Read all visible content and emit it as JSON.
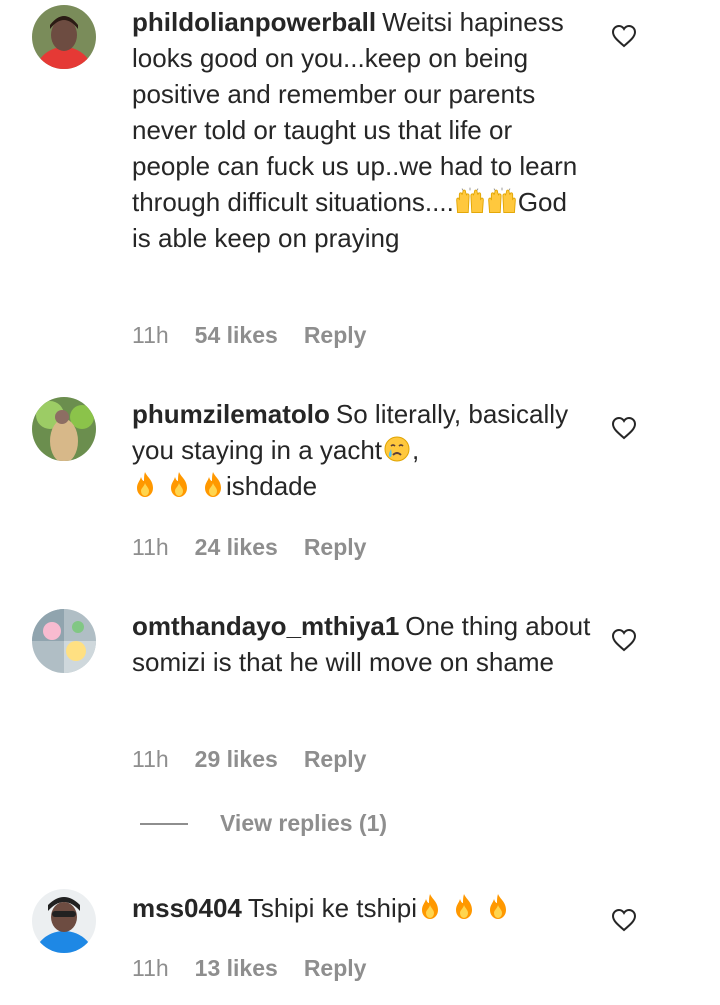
{
  "comments": [
    {
      "username": "phildolianpowerball",
      "text_1": "Weitsi hapiness looks good on you...keep on being positive and remember our parents never told or taught us that life or people can fuck us up..we had to learn through difficult situations....",
      "text_2": "God is able keep on praying",
      "time": "11h",
      "likes": "54 likes",
      "reply": "Reply"
    },
    {
      "username": "phumzilematolo",
      "text_1": "So literally, basically you staying in a yacht",
      "text_2": ",",
      "text_3": "ishdade",
      "time": "11h",
      "likes": "24 likes",
      "reply": "Reply"
    },
    {
      "username": "omthandayo_mthiya1",
      "text_1": "One thing about somizi is that he will move on shame",
      "time": "11h",
      "likes": "29 likes",
      "reply": "Reply"
    },
    {
      "username": "mss0404",
      "text_1": "Tshipi ke tshipi",
      "time": "11h",
      "likes": "13 likes",
      "reply": "Reply"
    }
  ],
  "view_replies": "View replies (1)",
  "icons": {
    "heart": "heart-outline-icon",
    "emoji_raising_hands": "raising-hands-emoji",
    "emoji_fire": "fire-emoji",
    "emoji_crying": "crying-face-emoji"
  },
  "colors": {
    "text": "#262626",
    "meta": "#8e8e8e",
    "fire": "#ff9800",
    "hands": "#ffc83d"
  }
}
